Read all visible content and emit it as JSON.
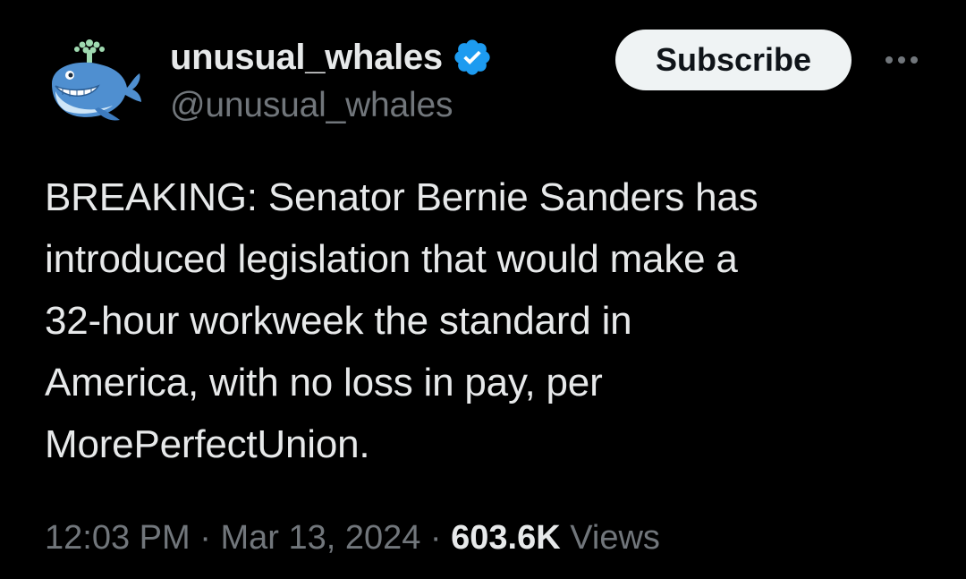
{
  "author": {
    "display_name": "unusual_whales",
    "handle": "@unusual_whales",
    "verified_icon": "verified-badge-icon",
    "avatar_icon": "whale-avatar-icon"
  },
  "actions": {
    "subscribe_label": "Subscribe",
    "more_icon": "more-options-icon"
  },
  "tweet": {
    "text": "BREAKING: Senator Bernie Sanders has\nintroduced legislation that would make a\n32-hour workweek the standard in\nAmerica, with no loss in pay, per\nMorePerfectUnion."
  },
  "meta": {
    "time": "12:03 PM",
    "separator": " · ",
    "date": "Mar 13, 2024",
    "views_count": "603.6K",
    "views_label": " Views"
  },
  "colors": {
    "background": "#000000",
    "primary_text": "#e7e9ea",
    "secondary_text": "#71767b",
    "verified_blue": "#1d9bf0",
    "button_bg": "#eff3f4"
  }
}
